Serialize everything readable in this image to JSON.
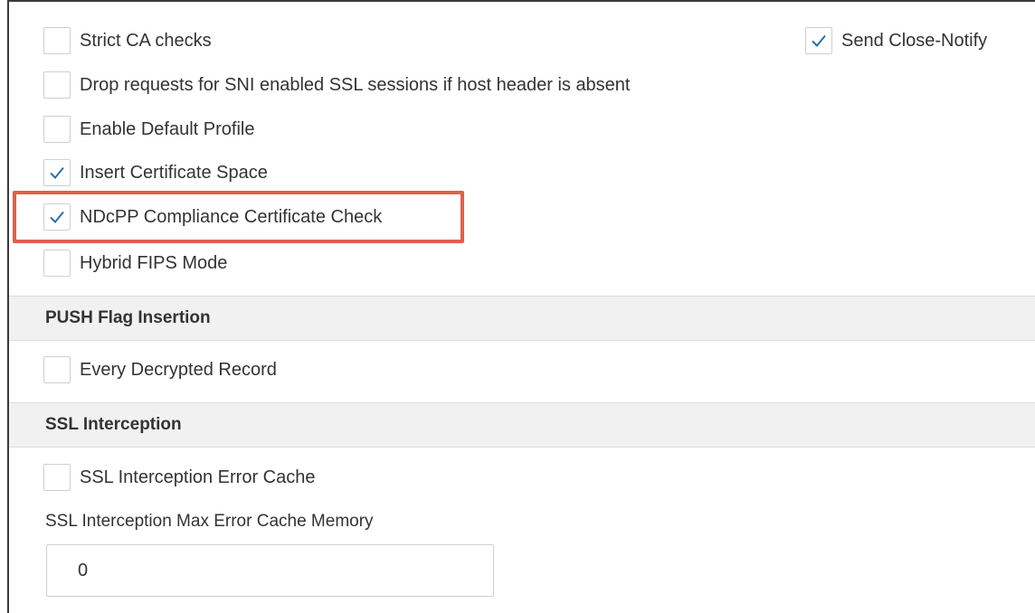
{
  "options": {
    "strict_ca": {
      "label": "Strict CA checks",
      "checked": false
    },
    "send_close_notify": {
      "label": "Send Close-Notify",
      "checked": true
    },
    "drop_sni": {
      "label": "Drop requests for SNI enabled SSL sessions if host header is absent",
      "checked": false
    },
    "default_profile": {
      "label": "Enable Default Profile",
      "checked": false
    },
    "insert_cert_space": {
      "label": "Insert Certificate Space",
      "checked": true
    },
    "ndcpp": {
      "label": "NDcPP Compliance Certificate Check",
      "checked": true
    },
    "hybrid_fips": {
      "label": "Hybrid FIPS Mode",
      "checked": false
    }
  },
  "push_flag": {
    "title": "PUSH Flag Insertion",
    "every_decrypted": {
      "label": "Every Decrypted Record",
      "checked": false
    }
  },
  "ssl_interception": {
    "title": "SSL Interception",
    "error_cache": {
      "label": "SSL Interception Error Cache",
      "checked": false
    },
    "max_error_cache_label": "SSL Interception Max Error Cache Memory",
    "max_error_cache_value": "0"
  },
  "colors": {
    "check": "#2c6fad",
    "highlight": "#e0604a",
    "section_bg": "#f1f1f1"
  }
}
